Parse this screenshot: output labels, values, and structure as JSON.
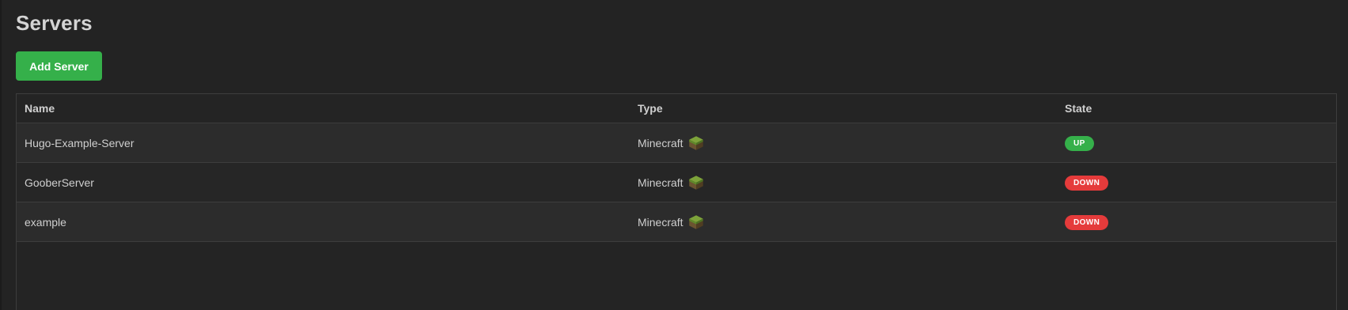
{
  "page": {
    "title": "Servers",
    "add_button_label": "Add Server"
  },
  "table": {
    "columns": [
      "Name",
      "Type",
      "State"
    ],
    "rows": [
      {
        "name": "Hugo-Example-Server",
        "type": "Minecraft",
        "type_icon": "minecraft-grass-block-icon",
        "state": "UP",
        "state_color": "#35b04a"
      },
      {
        "name": "GooberServer",
        "type": "Minecraft",
        "type_icon": "minecraft-grass-block-icon",
        "state": "DOWN",
        "state_color": "#e53b3b"
      },
      {
        "name": "example",
        "type": "Minecraft",
        "type_icon": "minecraft-grass-block-icon",
        "state": "DOWN",
        "state_color": "#e53b3b"
      }
    ]
  },
  "colors": {
    "background": "#232323",
    "accent_green": "#35b04a",
    "status_down": "#e53b3b"
  }
}
